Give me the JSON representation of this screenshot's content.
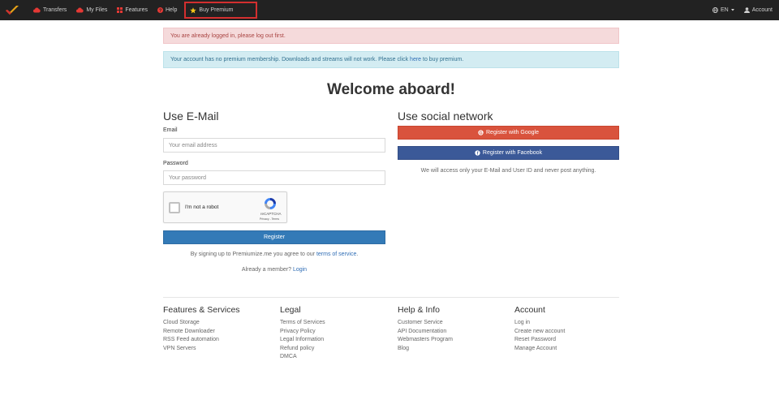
{
  "nav": {
    "items": [
      {
        "label": "Transfers",
        "icon": "cloud-icon"
      },
      {
        "label": "My Files",
        "icon": "cloud-icon"
      },
      {
        "label": "Features",
        "icon": "grid-icon"
      },
      {
        "label": "Help",
        "icon": "question-circle-icon"
      },
      {
        "label": "Buy Premium",
        "icon": "star-icon"
      }
    ],
    "language": "EN",
    "account": "Account"
  },
  "alerts": {
    "logged_in": "You are already logged in, please log out first.",
    "premium_prefix": "Your account has no premium membership. Downloads and streams will not work. Please click ",
    "premium_link": "here",
    "premium_suffix": " to buy premium."
  },
  "welcome": "Welcome aboard!",
  "email_section": {
    "title": "Use E-Mail",
    "email_label": "Email",
    "email_placeholder": "Your email address",
    "password_label": "Password",
    "password_placeholder": "Your password",
    "captcha_text": "I'm not a robot",
    "captcha_brand": "reCAPTCHA",
    "captcha_terms": "Privacy - Terms",
    "register_button": "Register",
    "terms_prefix": "By signing up to Premiumize.me you agree to our ",
    "terms_link": "terms of service",
    "terms_suffix": ".",
    "member_prefix": "Already a member? ",
    "member_link": "Login"
  },
  "social_section": {
    "title": "Use social network",
    "google_button": "Register with Google",
    "facebook_button": "Register with Facebook",
    "note": "We will access only your E-Mail and User ID and never post anything."
  },
  "footer": {
    "features": {
      "title": "Features & Services",
      "links": [
        "Cloud Storage",
        "Remote Downloader",
        "RSS Feed automation",
        "VPN Servers"
      ]
    },
    "legal": {
      "title": "Legal",
      "links": [
        "Terms of Services",
        "Privacy Policy",
        "Legal Information",
        "Refund policy",
        "DMCA"
      ]
    },
    "help": {
      "title": "Help & Info",
      "links": [
        "Customer Service",
        "API Documentation",
        "Webmasters Program",
        "Blog"
      ]
    },
    "account": {
      "title": "Account",
      "links": [
        "Log in",
        "Create new account",
        "Reset Password",
        "Manage Account"
      ]
    }
  },
  "colors": {
    "navbar": "#222222",
    "google": "#d9533d",
    "facebook": "#3b5998",
    "primary": "#337ab7",
    "highlight_box": "#d32f2f"
  }
}
